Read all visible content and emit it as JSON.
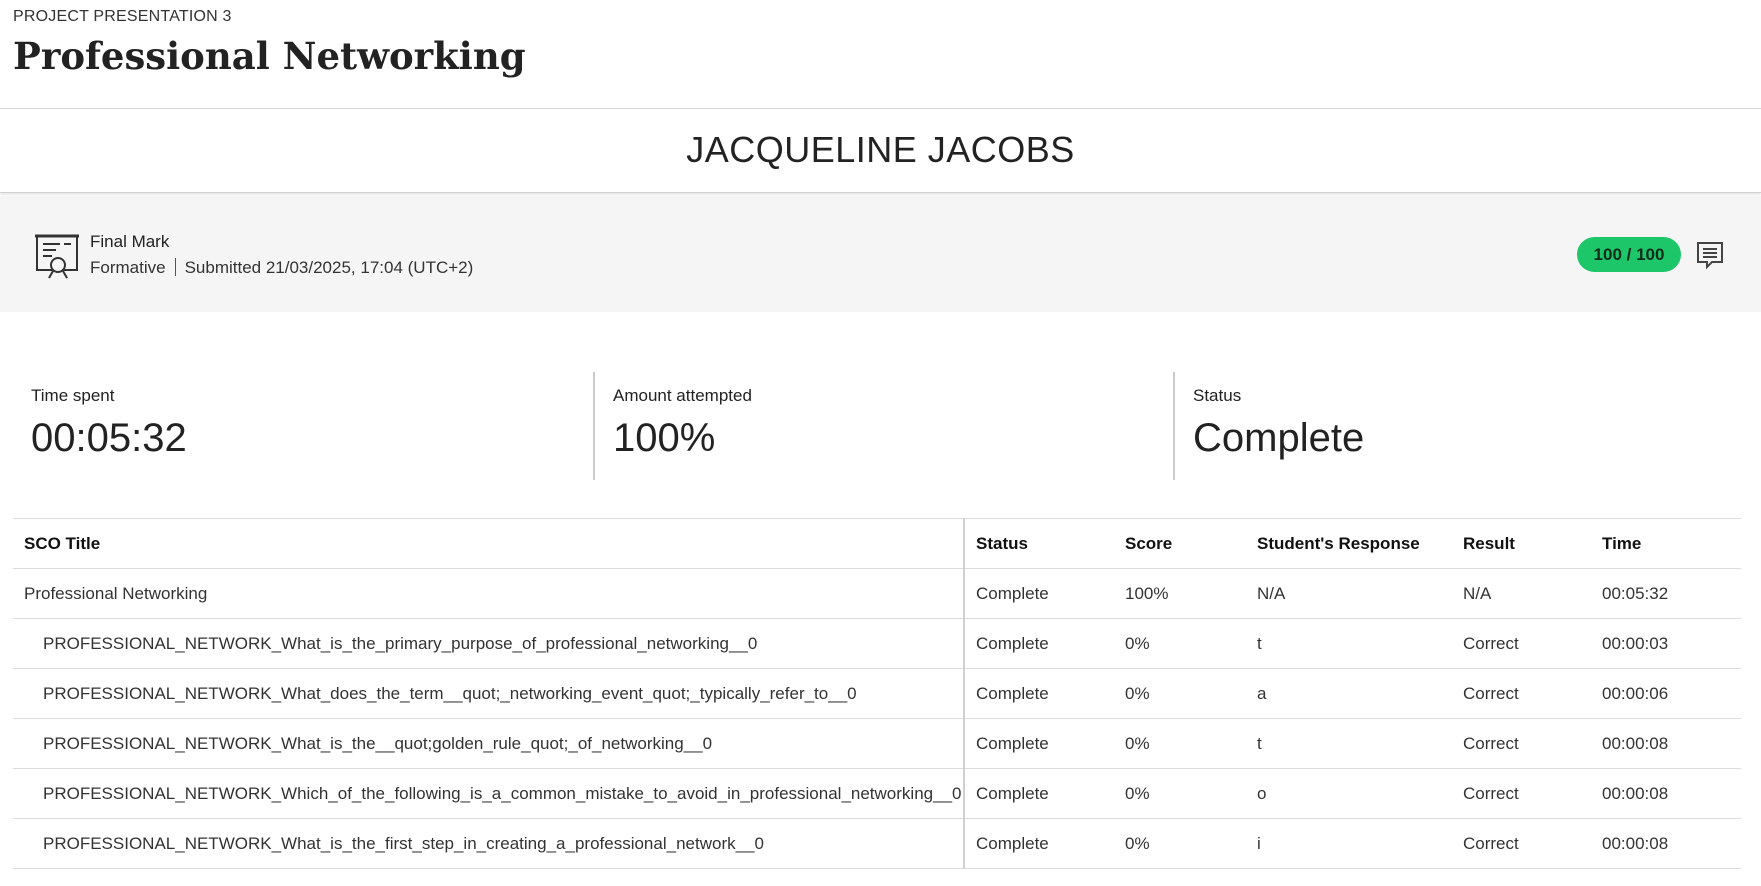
{
  "header": {
    "eyebrow": "PROJECT PRESENTATION 3",
    "title": "Professional Networking"
  },
  "student": {
    "name": "JACQUELINE JACOBS"
  },
  "mark": {
    "icon": "certificate-icon",
    "title": "Final Mark",
    "type": "Formative",
    "submitted": "Submitted 21/03/2025, 17:04 (UTC+2)",
    "score": "100 / 100",
    "score_color": "#1ec66a",
    "comment_icon": "comment-icon"
  },
  "stats": [
    {
      "label": "Time spent",
      "value": "00:05:32"
    },
    {
      "label": "Amount attempted",
      "value": "100%"
    },
    {
      "label": "Status",
      "value": "Complete"
    }
  ],
  "table": {
    "headers": [
      "SCO Title",
      "Status",
      "Score",
      "Student's Response",
      "Result",
      "Time"
    ],
    "rows": [
      [
        "Professional Networking",
        "Complete",
        "100%",
        "N/A",
        "N/A",
        "00:05:32"
      ],
      [
        "PROFESSIONAL_NETWORK_What_is_the_primary_purpose_of_professional_networking__0",
        "Complete",
        "0%",
        "t",
        "Correct",
        "00:00:03"
      ],
      [
        "PROFESSIONAL_NETWORK_What_does_the_term__quot;_networking_event_quot;_typically_refer_to__0",
        "Complete",
        "0%",
        "a",
        "Correct",
        "00:00:06"
      ],
      [
        "PROFESSIONAL_NETWORK_What_is_the__quot;golden_rule_quot;_of_networking__0",
        "Complete",
        "0%",
        "t",
        "Correct",
        "00:00:08"
      ],
      [
        "PROFESSIONAL_NETWORK_Which_of_the_following_is_a_common_mistake_to_avoid_in_professional_networking__0",
        "Complete",
        "0%",
        "o",
        "Correct",
        "00:00:08"
      ],
      [
        "PROFESSIONAL_NETWORK_What_is_the_first_step_in_creating_a_professional_network__0",
        "Complete",
        "0%",
        "i",
        "Correct",
        "00:00:08"
      ]
    ]
  }
}
